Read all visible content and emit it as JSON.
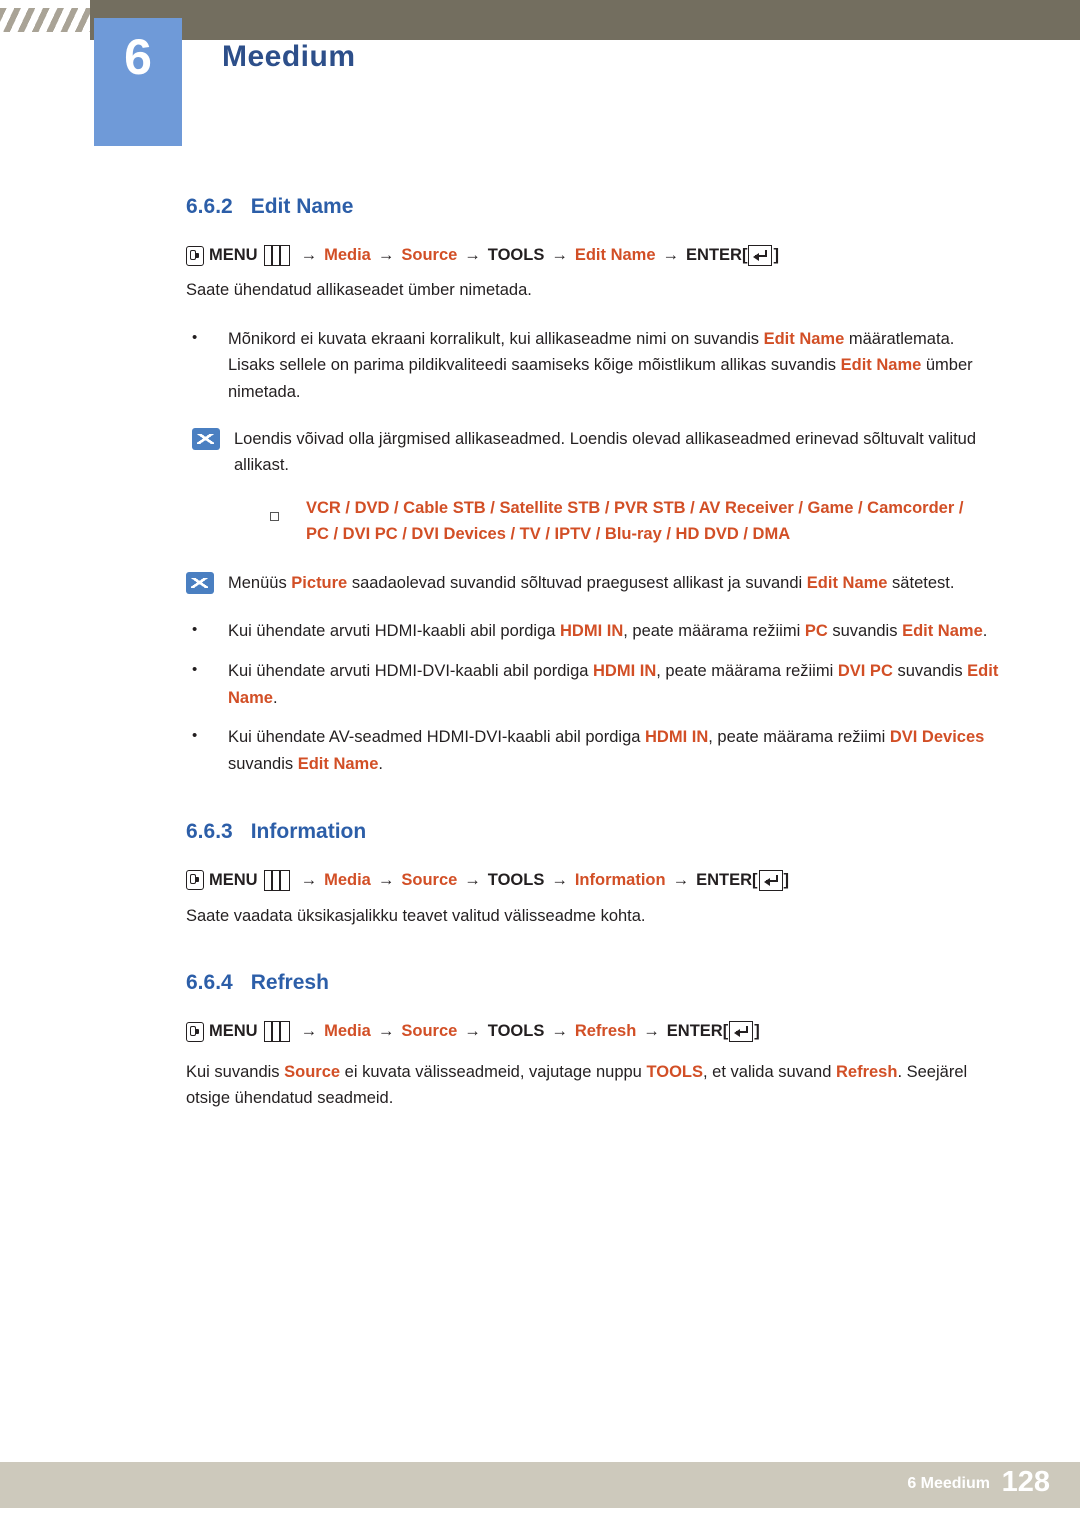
{
  "header": {
    "chapter_number": "6",
    "chapter_title": "Meedium"
  },
  "sections": [
    {
      "number": "6.6.2",
      "title": "Edit Name",
      "path": {
        "menu_label": "MENU",
        "items": [
          "Media",
          "Source",
          "TOOLS",
          "Edit Name"
        ],
        "enter_label": "ENTER"
      },
      "intro": "Saate ühendatud allikaseadet ümber nimetada.",
      "bullets": [
        {
          "parts": [
            {
              "t": "Mõnikord ei kuvata ekraani korralikult, kui allikaseadme nimi on suvandis ",
              "s": "n"
            },
            {
              "t": "Edit Name",
              "s": "o"
            },
            {
              "t": " määratlemata. Lisaks sellele on parima pildikvaliteedi saamiseks kõige mõistlikum allikas suvandis ",
              "s": "n"
            },
            {
              "t": "Edit Name",
              "s": "o"
            },
            {
              "t": " ümber nimetada.",
              "s": "n"
            }
          ]
        }
      ],
      "note1": "Loendis võivad olla järgmised allikaseadmed. Loendis olevad allikaseadmed erinevad sõltuvalt valitud allikast.",
      "device_list_line1": "VCR / DVD / Cable STB / Satellite STB / PVR STB / AV Receiver / Game / Camcorder /",
      "device_list_line2": "PC / DVI PC / DVI Devices / TV / IPTV / Blu-ray / HD DVD / DMA",
      "note2": [
        {
          "t": "Menüüs ",
          "s": "n"
        },
        {
          "t": "Picture",
          "s": "o"
        },
        {
          "t": " saadaolevad suvandid sõltuvad praegusest allikast ja suvandi ",
          "s": "n"
        },
        {
          "t": "Edit Name",
          "s": "o"
        },
        {
          "t": " sätetest.",
          "s": "n"
        }
      ],
      "bullets2": [
        {
          "parts": [
            {
              "t": "Kui ühendate arvuti HDMI-kaabli abil pordiga ",
              "s": "n"
            },
            {
              "t": "HDMI IN",
              "s": "o"
            },
            {
              "t": ", peate määrama režiimi ",
              "s": "n"
            },
            {
              "t": "PC",
              "s": "o"
            },
            {
              "t": " suvandis ",
              "s": "n"
            },
            {
              "t": "Edit Name",
              "s": "o"
            },
            {
              "t": ".",
              "s": "n"
            }
          ]
        },
        {
          "parts": [
            {
              "t": "Kui ühendate arvuti HDMI-DVI-kaabli abil pordiga ",
              "s": "n"
            },
            {
              "t": "HDMI IN",
              "s": "o"
            },
            {
              "t": ", peate määrama režiimi ",
              "s": "n"
            },
            {
              "t": "DVI PC",
              "s": "o"
            },
            {
              "t": " suvandis ",
              "s": "n"
            },
            {
              "t": "Edit Name",
              "s": "o"
            },
            {
              "t": ".",
              "s": "n"
            }
          ]
        },
        {
          "parts": [
            {
              "t": "Kui ühendate AV-seadmed HDMI-DVI-kaabli abil pordiga ",
              "s": "n"
            },
            {
              "t": "HDMI IN",
              "s": "o"
            },
            {
              "t": ", peate määrama režiimi ",
              "s": "n"
            },
            {
              "t": "DVI Devices",
              "s": "o"
            },
            {
              "t": " suvandis ",
              "s": "n"
            },
            {
              "t": "Edit Name",
              "s": "o"
            },
            {
              "t": ".",
              "s": "n"
            }
          ]
        }
      ]
    },
    {
      "number": "6.6.3",
      "title": "Information",
      "path": {
        "menu_label": "MENU",
        "items": [
          "Media",
          "Source",
          "TOOLS",
          "Information"
        ],
        "enter_label": "ENTER"
      },
      "intro": "Saate vaadata üksikasjalikku teavet valitud välisseadme kohta."
    },
    {
      "number": "6.6.4",
      "title": "Refresh",
      "path": {
        "menu_label": "MENU",
        "items": [
          "Media",
          "Source",
          "TOOLS",
          "Refresh"
        ],
        "enter_label": "ENTER"
      },
      "body": [
        {
          "t": "Kui suvandis ",
          "s": "n"
        },
        {
          "t": "Source",
          "s": "o"
        },
        {
          "t": " ei kuvata välisseadmeid, vajutage nuppu ",
          "s": "n"
        },
        {
          "t": "TOOLS",
          "s": "o"
        },
        {
          "t": ", et valida suvand ",
          "s": "n"
        },
        {
          "t": "Refresh",
          "s": "o"
        },
        {
          "t": ". Seejärel otsige ühendatud seadmeid.",
          "s": "n"
        }
      ]
    }
  ],
  "footer": {
    "label": "6 Meedium",
    "page": "128"
  },
  "colors": {
    "header_bar": "#736e5f",
    "chapter_badge": "#6f9ad8",
    "heading_blue": "#2c5ea8",
    "accent_orange": "#d24f26",
    "footer_bar": "#cdc9bc"
  }
}
